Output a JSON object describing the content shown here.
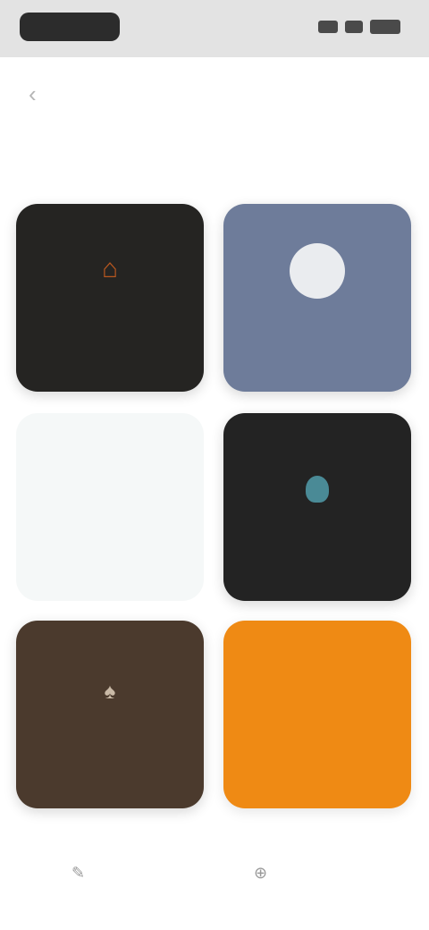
{
  "status_bar": {
    "time": "",
    "icons": [
      "signal-icon",
      "wifi-icon",
      "battery-icon"
    ]
  },
  "header": {
    "back_icon": "‹",
    "title": ""
  },
  "tiles": [
    {
      "name": "",
      "mark": "⌂",
      "background": "#252422",
      "accent": "#b8571f"
    },
    {
      "name": "",
      "mark": "",
      "background": "#6e7c9a",
      "accent": "#eaecef"
    },
    {
      "name": "",
      "mark": "",
      "background": "#f5f8f8",
      "accent": "#4a8fb3"
    },
    {
      "name": "",
      "mark": "",
      "background": "#232323",
      "accent": "#4a8a96"
    },
    {
      "name": "",
      "mark": "♠",
      "background": "#4b3a2d",
      "accent": "#d2c3b0"
    },
    {
      "name": "",
      "mark": "",
      "background": "#ef8a14",
      "accent": "#6b3d08"
    }
  ],
  "bottom_actions": {
    "left": {
      "icon": "✎",
      "label": ""
    },
    "right": {
      "icon": "⊕",
      "label": ""
    }
  }
}
